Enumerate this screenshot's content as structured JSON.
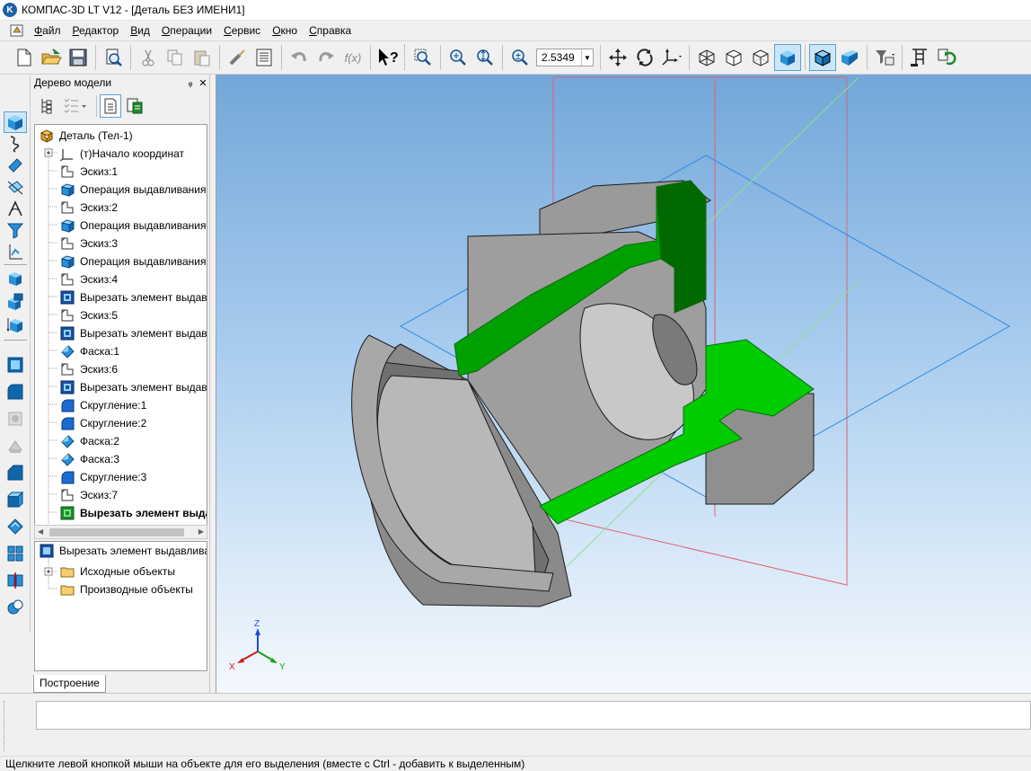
{
  "window": {
    "title": "КОМПАС-3D LT V12 - [Деталь БЕЗ ИМЕНИ1]"
  },
  "menu": {
    "items": [
      {
        "label": "Файл",
        "underline": "Ф",
        "rest": "айл"
      },
      {
        "label": "Редактор",
        "underline": "Р",
        "rest": "едактор"
      },
      {
        "label": "Вид",
        "underline": "В",
        "rest": "ид"
      },
      {
        "label": "Операции",
        "underline": "О",
        "rest": "перации"
      },
      {
        "label": "Сервис",
        "underline": "С",
        "rest": "ервис"
      },
      {
        "label": "Окно",
        "underline": "О",
        "rest": "кно"
      },
      {
        "label": "Справка",
        "underline": "С",
        "rest": "правка"
      }
    ]
  },
  "toolbar": {
    "zoom_value": "2.5349",
    "buttons": [
      "new-document-icon",
      "open-folder-icon",
      "save-icon",
      "print-preview-icon",
      "cut-icon",
      "copy-icon",
      "paste-icon",
      "properties-brush-icon",
      "variables-table-icon",
      "undo-icon",
      "redo-icon",
      "function-fx-icon",
      "context-help-icon",
      "zoom-window-icon",
      "zoom-dynamic-icon",
      "zoom-fit-icon",
      "zoom-scale-icon",
      "pan-icon",
      "rotate-icon",
      "orientation-icon",
      "wireframe-icon",
      "hidden-lines-icon",
      "thin-hidden-lines-icon",
      "shaded-icon",
      "shaded-edges-icon",
      "perspective-icon",
      "view-filter-icon",
      "library-tree-icon",
      "refresh-icon"
    ],
    "fx_label": "f(x)"
  },
  "tree_panel": {
    "title": "Дерево модели",
    "pin": "ᵩ",
    "close": "✕",
    "root": "Деталь (Тел-1)",
    "items": [
      {
        "label": "(т)Начало координат",
        "icon": "origin-icon"
      },
      {
        "label": "Эскиз:1",
        "icon": "sketch-icon"
      },
      {
        "label": "Операция выдавливания",
        "icon": "extrude-icon"
      },
      {
        "label": "Эскиз:2",
        "icon": "sketch-icon"
      },
      {
        "label": "Операция выдавливания",
        "icon": "extrude-icon"
      },
      {
        "label": "Эскиз:3",
        "icon": "sketch-icon"
      },
      {
        "label": "Операция выдавливания",
        "icon": "extrude-icon"
      },
      {
        "label": "Эскиз:4",
        "icon": "sketch-icon"
      },
      {
        "label": "Вырезать элемент выдав.",
        "icon": "cut-extrude-icon"
      },
      {
        "label": "Эскиз:5",
        "icon": "sketch-icon"
      },
      {
        "label": "Вырезать элемент выдав.",
        "icon": "cut-extrude-icon"
      },
      {
        "label": "Фаска:1",
        "icon": "chamfer-icon"
      },
      {
        "label": "Эскиз:6",
        "icon": "sketch-icon"
      },
      {
        "label": "Вырезать элемент выдав.",
        "icon": "cut-extrude-icon"
      },
      {
        "label": "Скругление:1",
        "icon": "fillet-icon"
      },
      {
        "label": "Скругление:2",
        "icon": "fillet-icon"
      },
      {
        "label": "Фаска:2",
        "icon": "chamfer-icon"
      },
      {
        "label": "Фаска:3",
        "icon": "chamfer-icon"
      },
      {
        "label": "Скругление:3",
        "icon": "fillet-icon"
      },
      {
        "label": "Эскиз:7",
        "icon": "sketch-icon"
      },
      {
        "label": "Вырезать элемент выда",
        "icon": "section-cut-icon"
      }
    ],
    "sub_root": "Вырезать элемент выдавлива",
    "sub_items": [
      {
        "label": "Исходные объекты"
      },
      {
        "label": "Производные объекты"
      }
    ],
    "tab": "Построение"
  },
  "viewport": {
    "axes": {
      "x": "X",
      "y": "Y",
      "z": "Z"
    },
    "section_color": "#00cc00",
    "body_color": "#8c8c8c"
  },
  "status": {
    "text": "Щелкните левой кнопкой мыши на объекте для его выделения (вместе с Ctrl - добавить к выделенным)"
  }
}
